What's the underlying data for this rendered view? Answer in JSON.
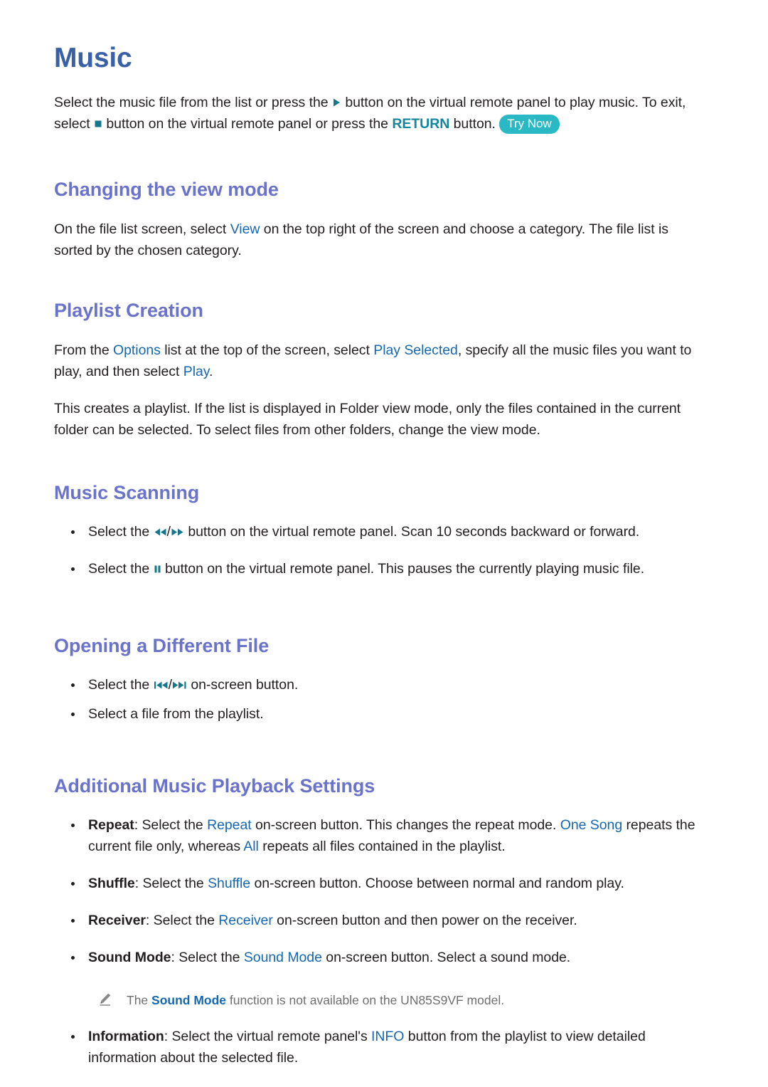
{
  "page": {
    "title": "Music",
    "intro": {
      "t1": "Select the music file from the list or press the ",
      "icon_play": "play-icon",
      "t2": " button on the virtual remote panel to play music. To exit, select ",
      "icon_stop": "stop-icon",
      "t3": " button on the virtual remote panel or press the ",
      "return_label": "RETURN",
      "t4": " button. ",
      "try_now_label": "Try Now"
    }
  },
  "sections": [
    {
      "heading": "Changing the view mode",
      "para": {
        "t1": "On the file list screen, select ",
        "link1": "View",
        "t2": " on the top right of the screen and choose a category. The file list is sorted by the chosen category."
      }
    },
    {
      "heading": "Playlist Creation",
      "para1": {
        "t1": "From the ",
        "link1": "Options",
        "t2": " list at the top of the screen, select ",
        "link2": "Play Selected",
        "t3": ", specify all the music files you want to play, and then select ",
        "link3": "Play",
        "t4": "."
      },
      "para2": "This creates a playlist. If the list is displayed in Folder view mode, only the files contained in the current folder can be selected. To select files from other folders, change the view mode."
    },
    {
      "heading": "Music Scanning",
      "bullets": [
        {
          "t1": "Select the ",
          "icon_a": "rewind-icon",
          "slash": "/",
          "icon_b": "fast-forward-icon",
          "t2": " button on the virtual remote panel. Scan 10 seconds backward or forward."
        },
        {
          "t1": "Select the ",
          "icon_a": "pause-icon",
          "t2": " button on the virtual remote panel. This pauses the currently playing music file."
        }
      ]
    },
    {
      "heading": "Opening a Different File",
      "bullets": [
        {
          "t1": "Select the ",
          "icon_a": "skip-previous-icon",
          "slash": "/",
          "icon_b": "skip-next-icon",
          "t2": " on-screen button."
        },
        {
          "t1": "Select a file from the playlist."
        }
      ]
    },
    {
      "heading": "Additional Music Playback Settings",
      "bullets": [
        {
          "label": "Repeat",
          "t1": ": Select the ",
          "link1": "Repeat",
          "t2": " on-screen button. This changes the repeat mode. ",
          "link2": "One Song",
          "t3": " repeats the current file only, whereas ",
          "link3": "All",
          "t4": " repeats all files contained in the playlist."
        },
        {
          "label": "Shuffle",
          "t1": ": Select the ",
          "link1": "Shuffle",
          "t2": " on-screen button. Choose between normal and random play."
        },
        {
          "label": "Receiver",
          "t1": ": Select the ",
          "link1": "Receiver",
          "t2": " on-screen button and then power on the receiver."
        },
        {
          "label": "Sound Mode",
          "t1": ": Select the ",
          "link1": "Sound Mode",
          "t2": " on-screen button. Select a sound mode."
        }
      ],
      "note": {
        "icon": "pencil-icon",
        "t1": "The ",
        "link1": "Sound Mode",
        "t2": " function is not available on the UN85S9VF model."
      },
      "last_bullet": {
        "label": "Information",
        "t1": ": Select the virtual remote panel's ",
        "link1": "INFO",
        "t2": " button from the playlist to view detailed information about the selected file."
      }
    }
  ],
  "colors": {
    "title_blue": "#3a61a8",
    "heading_purple": "#6b72c9",
    "link_blue": "#1567b2",
    "link_teal": "#13879f",
    "badge_teal": "#2ab9c4",
    "icon_teal": "#14778c",
    "body_black": "#231f20",
    "note_gray": "#6e6e6e"
  }
}
